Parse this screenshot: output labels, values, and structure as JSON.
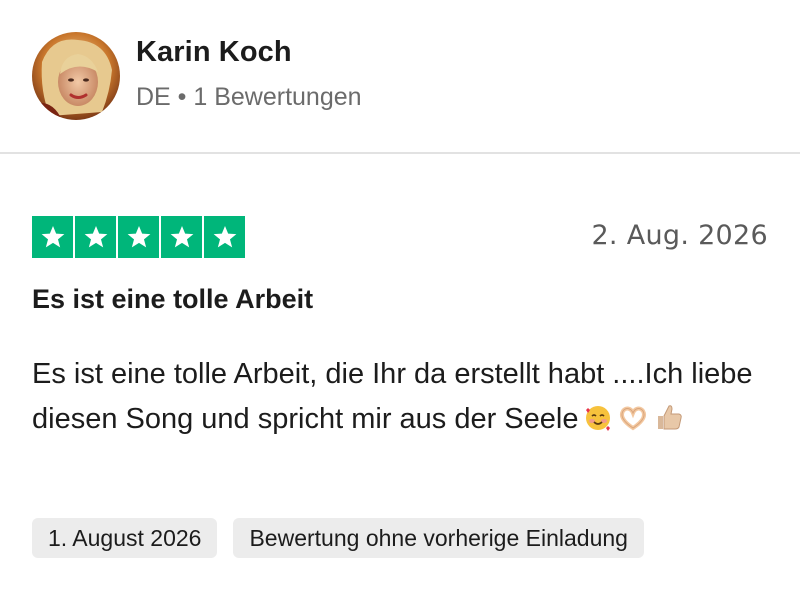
{
  "reviewer": {
    "name": "Karin Koch",
    "meta": "DE • 1 Bewertungen"
  },
  "review": {
    "rating": 5,
    "max_rating": 5,
    "star_color": "#00b67a",
    "date": "2. Aug. 2026",
    "title": "Es ist eine tolle Arbeit",
    "body": "Es ist eine tolle Arbeit, die Ihr da erstellt habt ....Ich liebe diesen Song und spricht mir aus der Seele",
    "emojis": [
      "smiling-face-with-hearts",
      "heart-hands",
      "thumbs-up"
    ]
  },
  "tags": [
    {
      "label": "1. August 2026"
    },
    {
      "label": "Bewertung ohne vorherige Einladung"
    }
  ]
}
